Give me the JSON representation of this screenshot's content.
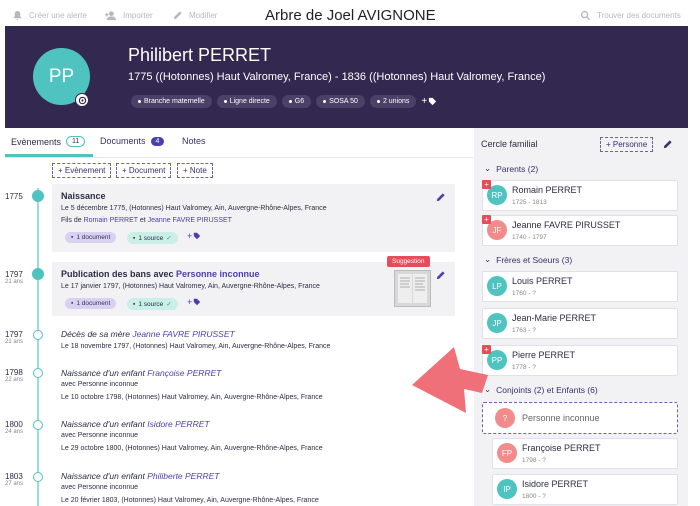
{
  "toolbar": {
    "create_alert": "Créer une alerte",
    "import": "Importer",
    "edit": "Modifier",
    "title": "Arbre de Joel AVIGNONE",
    "find_docs": "Trouver des documents"
  },
  "person": {
    "initials": "PP",
    "name": "Philibert PERRET",
    "dates": "1775 ((Hotonnes) Haut Valromey, France) - 1836 ((Hotonnes) Haut Valromey, France)",
    "chips": [
      "Branche maternelle",
      "Ligne directe",
      "G6",
      "SOSA 50",
      "2 unions"
    ]
  },
  "tabs": {
    "events": "Evènements",
    "events_count": "11",
    "documents": "Documents",
    "documents_count": "4",
    "notes": "Notes"
  },
  "add_buttons": {
    "event": "+ Evènement",
    "document": "+ Document",
    "note": "+ Note"
  },
  "events": [
    {
      "year": "1775",
      "title": "Naissance",
      "line1": "Le 5 décembre 1775, (Hotonnes) Haut Valromey, Ain, Auvergne-Rhône-Alpes, France",
      "line2_prefix": "Fils de ",
      "father": "Romain PERRET",
      "and": " et ",
      "mother": "Jeanne FAVRE PIRUSSET",
      "doc_pill": "1 document",
      "src_pill": "1 source"
    },
    {
      "year": "1797",
      "age": "21 ans",
      "title_prefix": "Publication des bans avec ",
      "title_link": "Personne inconnue",
      "line1": "Le 17 janvier 1797, (Hotonnes) Haut Valromey, Ain, Auvergne-Rhône-Alpes, France",
      "doc_pill": "1 document",
      "src_pill": "1 source",
      "suggestion": "Suggestion"
    },
    {
      "year": "1797",
      "age": "21 ans",
      "title_prefix": "Décès de sa mère ",
      "title_link": "Jeanne FAVRE PIRUSSET",
      "line1": "Le 18 novembre 1797, (Hotonnes) Haut Valromey, Ain, Auvergne-Rhône-Alpes, France"
    },
    {
      "year": "1798",
      "age": "22 ans",
      "title_prefix": "Naissance d'un enfant ",
      "title_link": "Françoise PERRET",
      "line0": "avec Personne inconnue",
      "line1": "Le 10 octobre 1798, (Hotonnes) Haut Valromey, Ain, Auvergne-Rhône-Alpes, France"
    },
    {
      "year": "1800",
      "age": "24 ans",
      "title_prefix": "Naissance d'un enfant ",
      "title_link": "Isidore PERRET",
      "line0": "avec Personne inconnue",
      "line1": "Le 29 octobre 1800, (Hotonnes) Haut Valromey, Ain, Auvergne-Rhône-Alpes, France"
    },
    {
      "year": "1803",
      "age": "27 ans",
      "title_prefix": "Naissance d'un enfant ",
      "title_link": "Philiberte PERRET",
      "line0": "avec Personne inconnue",
      "line1": "Le 20 février 1803, (Hotonnes) Haut Valromey, Ain, Auvergne-Rhône-Alpes, France"
    }
  ],
  "family": {
    "title": "Cercle familial",
    "add_person": "+ Personne",
    "parents_label": "Parents (2)",
    "siblings_label": "Frères et Soeurs (3)",
    "spouses_label": "Conjoints (2) et Enfants (6)",
    "parents": [
      {
        "initials": "RP",
        "name": "Romain PERRET",
        "dates": "1725 - 1813"
      },
      {
        "initials": "JF",
        "name": "Jeanne FAVRE PIRUSSET",
        "dates": "1740 - 1797"
      }
    ],
    "siblings": [
      {
        "initials": "LP",
        "name": "Louis PERRET",
        "dates": "1760 - ?"
      },
      {
        "initials": "JP",
        "name": "Jean-Marie PERRET",
        "dates": "1763 - ?"
      },
      {
        "initials": "PP",
        "name": "Pierre PERRET",
        "dates": "1778 - ?"
      }
    ],
    "spouse": {
      "initials": "?",
      "name": "Personne inconnue"
    },
    "children": [
      {
        "initials": "FP",
        "name": "Françoise PERRET",
        "dates": "1798 - ?"
      },
      {
        "initials": "IP",
        "name": "Isidore PERRET",
        "dates": "1800 - ?"
      }
    ]
  },
  "colors": {
    "header": "#33284f",
    "teal": "#4fc3c0",
    "purple": "#4b3fb0",
    "red": "#e84b5a",
    "pink": "#f28b8b"
  }
}
